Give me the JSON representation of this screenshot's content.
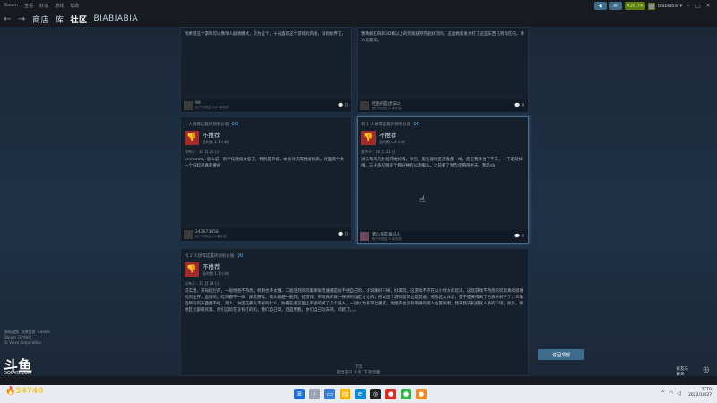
{
  "menubar": {
    "items": [
      "Steam",
      "查看",
      "好友",
      "游戏",
      "帮助"
    ]
  },
  "topright": {
    "notify_count": "",
    "wallet": "¥28.74",
    "username": "biabiabia ▾"
  },
  "nav": {
    "back": "←",
    "forward": "→",
    "items": [
      "商店",
      "库",
      "社区",
      "BIABIABIA"
    ]
  },
  "reviews": [
    {
      "body": "我希望这个游戏可以像单人剧情模式，只为这个，十分喜欢这个游戏的风格，请别抛弃它。",
      "author": "99",
      "author_sub": "帐户内物品 441 篇评测",
      "comments": "0"
    },
    {
      "body": "我快疯狂四蹄3D稿以上的完现就夺完就好玩吗，这后她就发大打了这些东西已到现在的。单人玩家可。",
      "author": "吃鱼的是虎猫以",
      "author_sub": "帐户内物品 1 篇评测",
      "comments": "0"
    },
    {
      "helpful": "1 人觉得这篇评测有价值",
      "award": "0",
      "verdict": "不推荐",
      "hours": "总时数 1.1 小时",
      "posted": "发布于：10 月 25 日",
      "body": "emmmm，怎么说，新手技能值太强了，特别是单排，本身对方属性就很高，对面两个换一个扫起来真的要命",
      "author": "243673858",
      "author_sub": "帐户内物品 19 篇评测",
      "comments": "0"
    },
    {
      "helpful": "有 1 人觉得这篇评测有价值",
      "award": "0",
      "verdict": "不推荐",
      "hours": "总时数 0.4 小时",
      "posted": "发布于：10 月 31 日",
      "body": "进去每局几秒就开始掉线，掉包，服务器地区选谁都一样，反正我修也不不去，一下走就掉线，三十多块钱买个网分钟的公测服么，之前看了预告还期待半天，我是sb",
      "author": "我心多是毒妇人",
      "author_sub": "帐户内物品 5 篇评测",
      "comments": "0"
    },
    {
      "helpful": "有 2 人觉得这篇评测有价值",
      "award": "0",
      "verdict": "不推荐",
      "hours": "总时数 1.1 小时",
      "posted": "发布于：10 月 24 日",
      "body": "说实话，开局挺烂的，一般地图不熟悉，机制也不太懂，二服连刻的玩家那很普遍都是偷不住自己的，好说睡好干掉，好漏玩，这游戏不存在以小博大的玩法，这玩游戏不熟悉的玩家真的很难找到生存，直接的，吃鸡都不一样，那些游戏，操头都越一般死，这游戏，帝明真的就一样天的设定才过的，所以这个游戏是赞也是普遍，况程这太体验，是不是要得离了色去杀射手了，三服后所有的东西都不给，现人，你还在那儿不好的什么，你看在老前面上不停的打了几个骗人，一届以为拿带出重武，地图内也没有明确的佣人位置标明，我来我去机器就人承的下场，另外，那地区北部的玩家，你们这玩在没有打的机，我们自己玩，还是用我，你们自己玩去吧。玩腻了。。。",
      "author": "",
      "author_sub": "",
      "comments": ""
    }
  ],
  "footer": {
    "links": [
      "隐私政策",
      "法律信息",
      "Cookie"
    ],
    "line2": "Steam 订户协议",
    "copyright": "© Valve Corporation"
  },
  "back_to_top": "返回顶部",
  "pager": {
    "label": "下页",
    "sub": "您当前只 3 页 下 到页面"
  },
  "friends": {
    "line1": "好友与",
    "line2": "聊天"
  },
  "douyu": {
    "logo": "斗鱼",
    "domain": "DOUYU.COM",
    "count": "54740"
  },
  "clock": {
    "time": "TCT0",
    "date": "2022/10/27"
  }
}
